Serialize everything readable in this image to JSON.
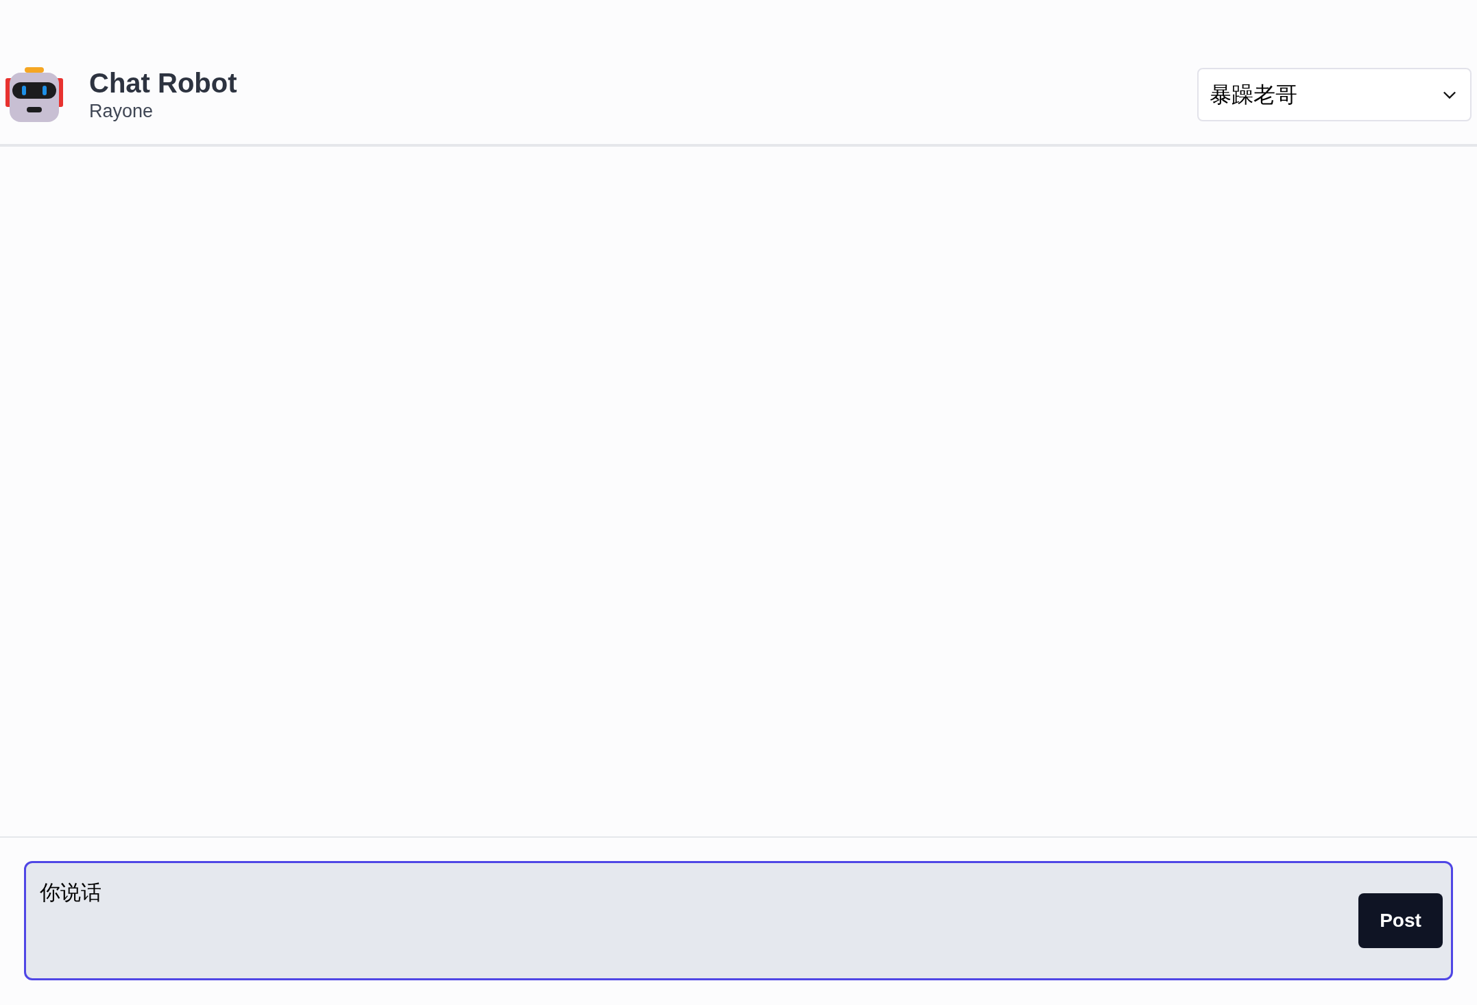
{
  "header": {
    "title": "Chat Robot",
    "subtitle": "Rayone"
  },
  "persona_select": {
    "value": "暴躁老哥"
  },
  "composer": {
    "value": "你说话",
    "focused": true,
    "button": "Post"
  }
}
